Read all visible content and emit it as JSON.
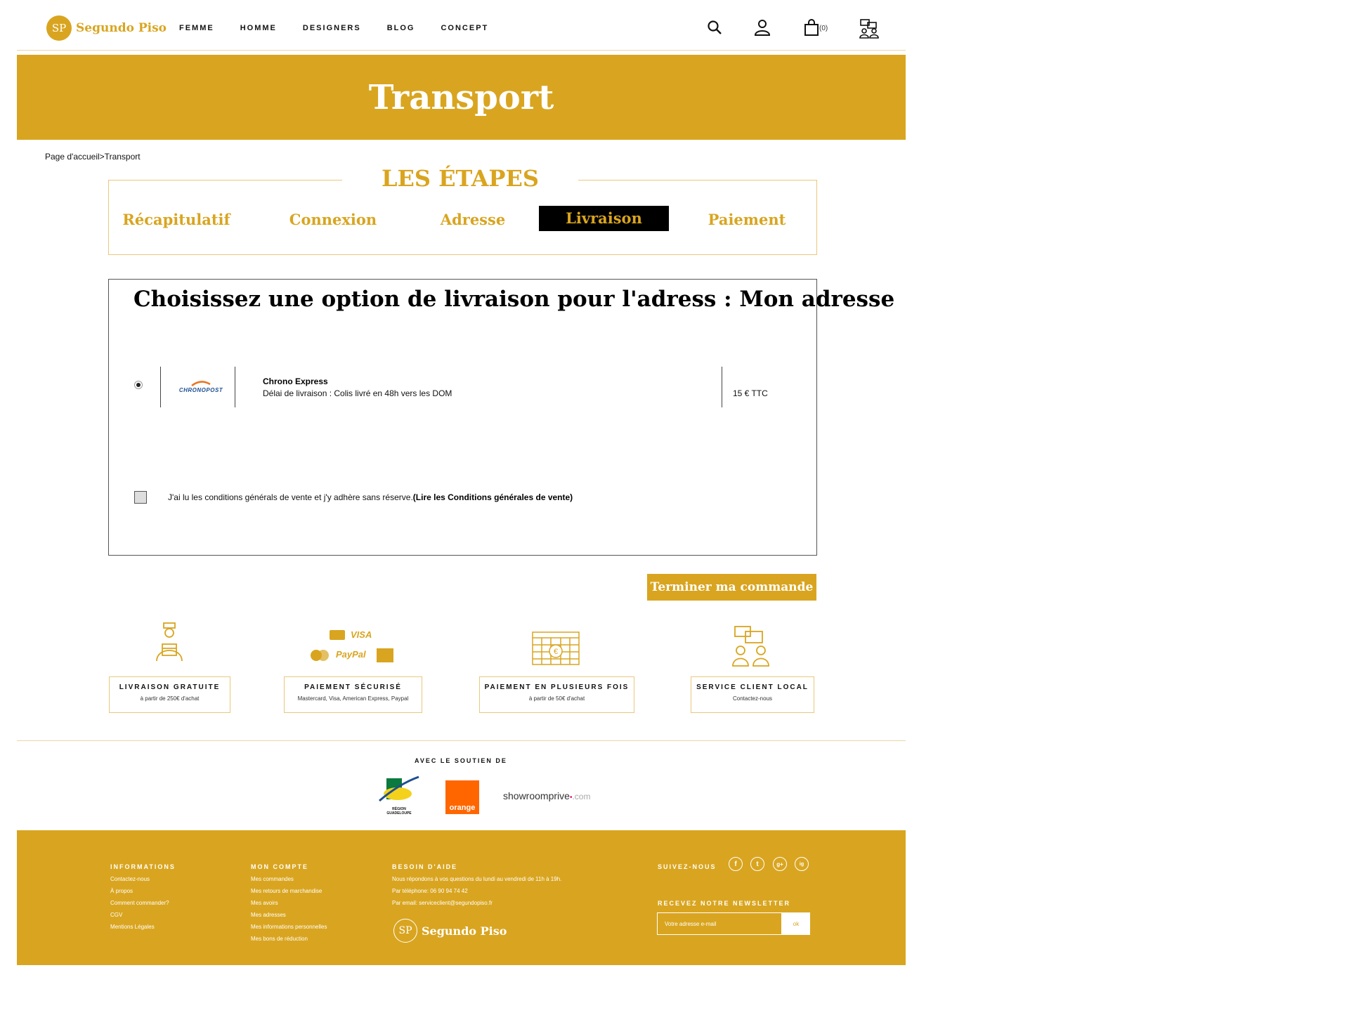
{
  "header": {
    "logo_initials": "SP",
    "logo_text": "Segundo Piso",
    "nav": [
      "FEMME",
      "HOMME",
      "DESIGNERS",
      "BLOG",
      "CONCEPT"
    ],
    "cart_count": "(0)"
  },
  "banner": {
    "title": "Transport"
  },
  "breadcrumb": "Page d'accueil>Transport",
  "steps": {
    "title": "LES ÉTAPES",
    "items": [
      "Récapitulatif",
      "Connexion",
      "Adresse",
      "Livraison",
      "Paiement"
    ],
    "active": "Livraison"
  },
  "delivery": {
    "title": "Choisissez une option de livraison pour l'adress : Mon adresse",
    "carrier_logo": "CHRONOPOST",
    "carrier_name": "Chrono Express",
    "carrier_desc": "Délai de livraison : Colis livré en 48h vers les DOM",
    "price": "15 € TTC",
    "cgv_text": "J'ai lu les conditions générals de vente et j'y adhère sans réserve.",
    "cgv_link": "(Lire les Conditions générales de vente)"
  },
  "finish_button": "Terminer ma commande",
  "features": [
    {
      "title": "LIVRAISON GRATUITE",
      "sub": "à partir de 250€ d'achat"
    },
    {
      "title": "PAIEMENT SÉCURISÉ",
      "sub": "Mastercard, Visa, American Express, Paypal"
    },
    {
      "title": "PAIEMENT EN PLUSIEURS FOIS",
      "sub": "à partir de 50€ d'achat"
    },
    {
      "title": "SERVICE CLIENT LOCAL",
      "sub": "Contactez-nous"
    }
  ],
  "payment_logos": {
    "visa": "VISA",
    "paypal": "PayPal"
  },
  "support": {
    "title": "AVEC LE SOUTIEN DE",
    "region": "RÉGION GUADELOUPE",
    "orange": "orange",
    "showroom": "showroomprive",
    "showroom_suffix": ".com"
  },
  "footer": {
    "informations": {
      "title": "INFORMATIONS",
      "links": [
        "Contactez-nous",
        "À propos",
        "Comment commander?",
        "CGV",
        "Mentions Légales"
      ]
    },
    "compte": {
      "title": "MON COMPTE",
      "links": [
        "Mes commandes",
        "Mes retours de marchandise",
        "Mes avoirs",
        "Mes adresses",
        "Mes informations personnelles",
        "Mes bons de réduction"
      ]
    },
    "aide": {
      "title": "BESOIN D'AIDE",
      "lines": [
        "Nous répondons à vos questions du lundi au vendredi de 11h à 19h.",
        "Par téléphone: 06 90 94 74 42",
        "Par email: serviceclient@segundopiso.fr"
      ]
    },
    "suivez": "SUIVEZ-NOUS",
    "social": [
      "f",
      "t",
      "g+",
      "ig"
    ],
    "newsletter_title": "RECEVEZ NOTRE NEWSLETTER",
    "newsletter_placeholder": "Votre adresse e-mail",
    "newsletter_btn": "ok"
  },
  "colors": {
    "accent": "#D9A520",
    "active_step_bg": "#000000"
  }
}
